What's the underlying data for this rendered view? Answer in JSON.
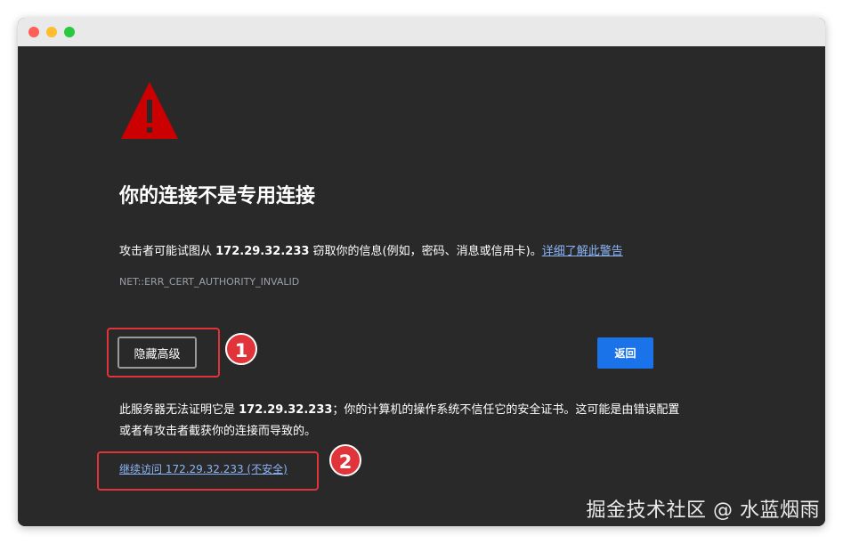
{
  "window": {
    "traffic_lights": [
      "#fe5f57",
      "#febc2e",
      "#28c840"
    ]
  },
  "page": {
    "icon": "warning-triangle-icon",
    "icon_color": "#cc0000",
    "heading": "你的连接不是专用连接",
    "message_prefix": "攻击者可能试图从 ",
    "host": "172.29.32.233",
    "message_suffix": " 窃取你的信息(例如，密码、消息或信用卡)。",
    "learn_more_link": "详细了解此警告",
    "error_code": "NET::ERR_CERT_AUTHORITY_INVALID",
    "hide_advanced_label": "隐藏高级",
    "back_label": "返回",
    "details_prefix": "此服务器无法证明它是 ",
    "details_host": "172.29.32.233",
    "details_suffix": "；你的计算机的操作系统不信任它的安全证书。这可能是由错误配置或者有攻击者截获你的连接而导致的。",
    "proceed_link": "继续访问 172.29.32.233 (不安全)",
    "link_color": "#8ab4f8",
    "button_color": "#1a73e8"
  },
  "annotations": {
    "badge_1": "1",
    "badge_2": "2",
    "color": "#e0343a"
  },
  "watermark": "掘金技术社区 @ 水蓝烟雨"
}
